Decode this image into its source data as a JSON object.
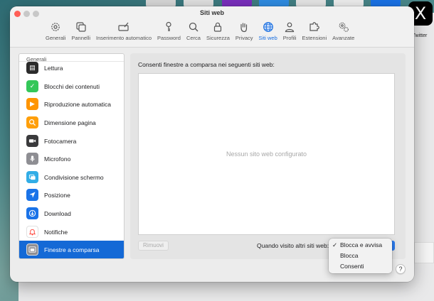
{
  "window": {
    "title": "Siti web"
  },
  "toolbar": {
    "items": [
      {
        "label": "Generali",
        "icon": "gear-icon"
      },
      {
        "label": "Pannelli",
        "icon": "tabs-icon"
      },
      {
        "label": "Inserimento automatico",
        "icon": "autofill-icon"
      },
      {
        "label": "Password",
        "icon": "key-icon"
      },
      {
        "label": "Cerca",
        "icon": "search-icon"
      },
      {
        "label": "Sicurezza",
        "icon": "lock-icon"
      },
      {
        "label": "Privacy",
        "icon": "hand-icon"
      },
      {
        "label": "Siti web",
        "icon": "globe-icon",
        "active": true
      },
      {
        "label": "Profili",
        "icon": "person-icon"
      },
      {
        "label": "Estensioni",
        "icon": "puzzle-icon"
      },
      {
        "label": "Avanzate",
        "icon": "advanced-gears-icon"
      }
    ]
  },
  "sidebar": {
    "header": "Generali",
    "items": [
      {
        "label": "Lettura",
        "icon": "reader-icon",
        "color": "#2b2b2b"
      },
      {
        "label": "Blocchi dei contenuti",
        "icon": "shield-check-icon",
        "color": "#34c759"
      },
      {
        "label": "Riproduzione automatica",
        "icon": "play-icon",
        "color": "#ff9500"
      },
      {
        "label": "Dimensione pagina",
        "icon": "zoom-icon",
        "color": "#ff9f0a"
      },
      {
        "label": "Fotocamera",
        "icon": "camera-icon",
        "color": "#3a3a3c"
      },
      {
        "label": "Microfono",
        "icon": "microphone-icon",
        "color": "#8e8e93"
      },
      {
        "label": "Condivisione schermo",
        "icon": "screen-share-icon",
        "color": "#32ade6"
      },
      {
        "label": "Posizione",
        "icon": "location-arrow-icon",
        "color": "#1a73e8"
      },
      {
        "label": "Download",
        "icon": "download-icon",
        "color": "#1a73e8"
      },
      {
        "label": "Notifiche",
        "icon": "bell-icon",
        "color": "#ff3b30"
      },
      {
        "label": "Finestre a comparsa",
        "icon": "popup-window-icon",
        "color": "#8e8e93",
        "selected": true
      }
    ]
  },
  "main": {
    "heading": "Consenti finestre a comparsa nei seguenti siti web:",
    "empty_text": "Nessun sito web configurato",
    "remove_label": "Rimuovi",
    "other_sites_label": "Quando visito altri siti web:"
  },
  "dropdown": {
    "selected": "Blocca e avvisa",
    "options": [
      "Blocca e avvisa",
      "Blocca",
      "Consenti"
    ]
  },
  "help_label": "?",
  "background": {
    "dock_label": "Twitter",
    "twitter_glyph": "X"
  },
  "colors": {
    "accent": "#1469d6",
    "close": "#ff5f57",
    "minimize": "#c8c8c8",
    "zoom": "#c8c8c8"
  }
}
